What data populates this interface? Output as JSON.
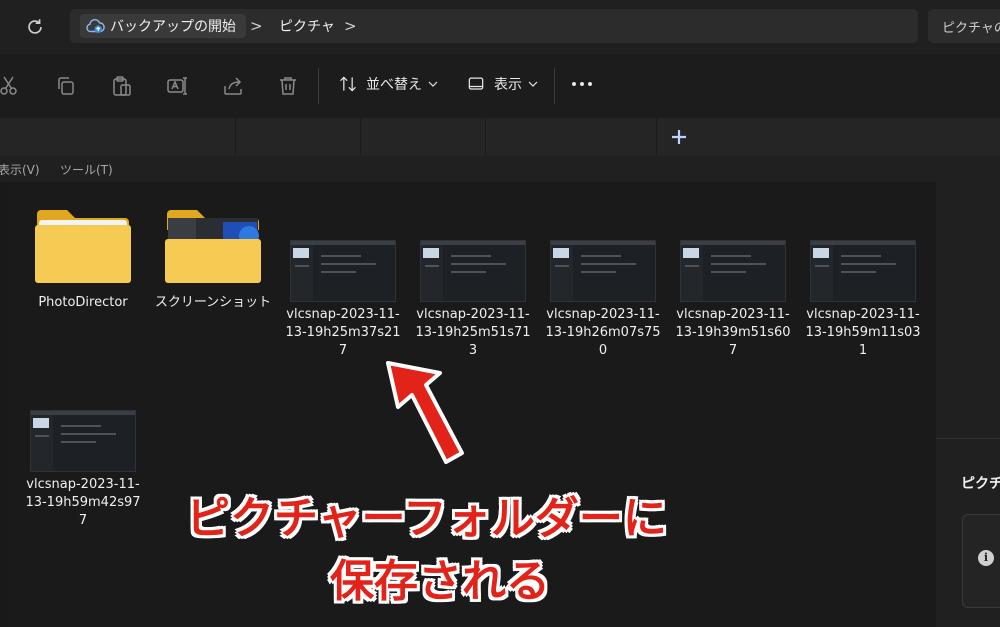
{
  "address_bar": {
    "breadcrumbs": [
      "バックアップの開始",
      "ピクチャ"
    ],
    "separator": ">",
    "search_placeholder": "ピクチャの"
  },
  "command_bar": {
    "sort_label": "並べ替え",
    "view_label": "表示",
    "icons": [
      "cut-icon",
      "copy-icon",
      "paste-icon",
      "rename-icon",
      "share-icon",
      "delete-icon"
    ]
  },
  "menu_bar": {
    "items": [
      "表示(V)",
      "ツール(T)"
    ]
  },
  "files": {
    "folders": [
      {
        "name": "PhotoDirector"
      },
      {
        "name": "スクリーンショット"
      }
    ],
    "images": [
      {
        "name": "vlcsnap-2023-11-13-19h25m37s217"
      },
      {
        "name": "vlcsnap-2023-11-13-19h25m51s713"
      },
      {
        "name": "vlcsnap-2023-11-13-19h26m07s750"
      },
      {
        "name": "vlcsnap-2023-11-13-19h39m51s607"
      },
      {
        "name": "vlcsnap-2023-11-13-19h59m11s031"
      },
      {
        "name": "vlcsnap-2023-11-13-19h59m42s977"
      }
    ]
  },
  "details_pane": {
    "title": "ピクチャ",
    "info_icon": "i"
  },
  "annotation": {
    "line1": "ピクチャーフォルダーに",
    "line2": "保存される",
    "color": "#e2231a"
  }
}
